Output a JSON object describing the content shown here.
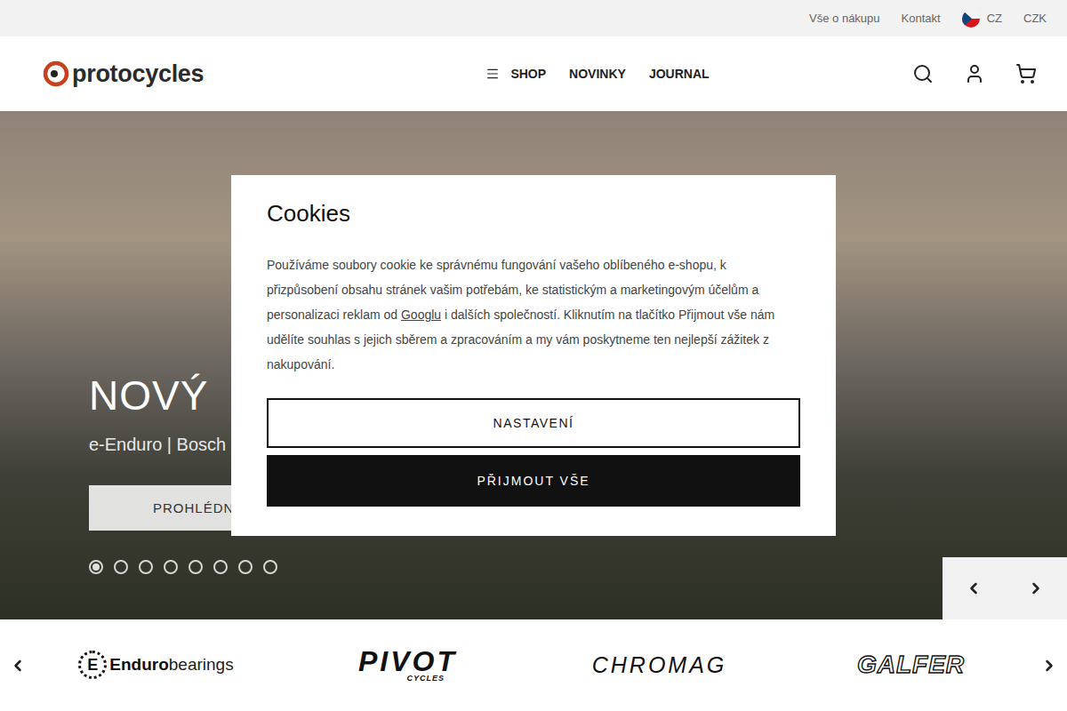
{
  "top_bar": {
    "links": [
      "Vše o nákupu",
      "Kontakt"
    ],
    "language": "CZ",
    "currency": "CZK"
  },
  "header": {
    "logo": "protocycles",
    "nav": [
      "SHOP",
      "NOVINKY",
      "JOURNAL"
    ]
  },
  "hero": {
    "title": "NOVÝ",
    "subtitle": "e-Enduro | Bosch",
    "button": "PROHLÉDN",
    "dots": [
      {
        "selected": true
      },
      {
        "selected": false
      },
      {
        "selected": false
      },
      {
        "selected": false
      },
      {
        "selected": false
      },
      {
        "selected": false
      },
      {
        "selected": false
      },
      {
        "selected": false
      }
    ]
  },
  "cookie_dialog": {
    "title": "Cookies",
    "text_before": "Používáme soubory cookie ke správnému fungování vašeho oblíbeného e-shopu, k přizpůsobení obsahu stránek vašim potřebám, ke statistickým a marketingovým účelům a personalizaci reklam od ",
    "link": "Googlu",
    "text_after": " i dalších společností. Kliknutím na tlačítko Přijmout vše nám udělíte souhlas s jejich sběrem a zpracováním a my vám poskytneme ten nejlepší zážitek z nakupování.",
    "buttons": [
      {
        "label": "NASTAVENÍ",
        "kind": "outline"
      },
      {
        "label": "PŘIJMOUT VŠE",
        "kind": "primary"
      }
    ]
  },
  "brands": [
    {
      "kind": "enduro",
      "mark": "E",
      "name": "Enduro",
      "suffix": "bearings"
    },
    {
      "kind": "pivot",
      "name": "PIVOT",
      "suffix": "CYCLES"
    },
    {
      "kind": "chromag",
      "name": "CHROMAG"
    },
    {
      "kind": "galfer",
      "name": "GALFER"
    }
  ]
}
